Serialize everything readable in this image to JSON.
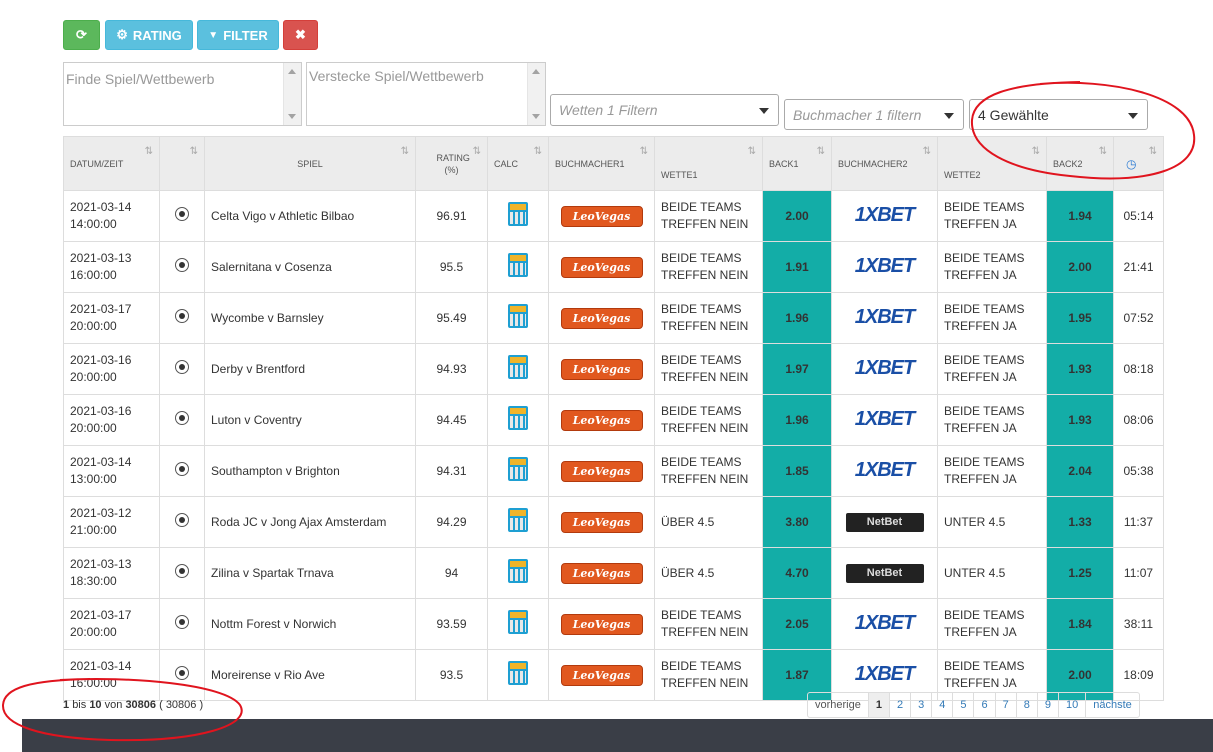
{
  "toolbar": {
    "refresh_icon": "refresh-icon",
    "rating_label": "RATING",
    "filter_label": "FILTER",
    "close_glyph": "✖",
    "refresh_glyph": "⟳",
    "rating_glyph": "⚙",
    "filter_glyph": "▼"
  },
  "filters": {
    "find_placeholder": "Finde Spiel/Wettbewerb",
    "hide_placeholder": "Verstecke Spiel/Wettbewerb",
    "bets_placeholder": "Wetten 1 Filtern",
    "bookmaker_placeholder": "Buchmacher 1 filtern",
    "selected_value": "4 Gewählte"
  },
  "table": {
    "headers": [
      "DATUM/ZEIT",
      "",
      "SPIEL",
      "RATING (%)",
      "CALC",
      "BUCHMACHER1",
      "WETTE1",
      "BACK1",
      "BUCHMACHER2",
      "WETTE2",
      "BACK2",
      ""
    ],
    "sort_glyph": "⇅",
    "clock_glyph": "◷",
    "rows": [
      {
        "date": "2021-03-14",
        "time": "14:00:00",
        "match": "Celta Vigo v Athletic Bilbao",
        "rating": "96.91",
        "bm1": "LeoVegas",
        "bet1a": "BEIDE TEAMS",
        "bet1b": "TREFFEN NEIN",
        "back1": "2.00",
        "bm2": "1XBET",
        "bet2a": "BEIDE TEAMS",
        "bet2b": "TREFFEN JA",
        "back2": "1.94",
        "timer": "05:14"
      },
      {
        "date": "2021-03-13",
        "time": "16:00:00",
        "match": "Salernitana v Cosenza",
        "rating": "95.5",
        "bm1": "LeoVegas",
        "bet1a": "BEIDE TEAMS",
        "bet1b": "TREFFEN NEIN",
        "back1": "1.91",
        "bm2": "1XBET",
        "bet2a": "BEIDE TEAMS",
        "bet2b": "TREFFEN JA",
        "back2": "2.00",
        "timer": "21:41"
      },
      {
        "date": "2021-03-17",
        "time": "20:00:00",
        "match": "Wycombe v Barnsley",
        "rating": "95.49",
        "bm1": "LeoVegas",
        "bet1a": "BEIDE TEAMS",
        "bet1b": "TREFFEN NEIN",
        "back1": "1.96",
        "bm2": "1XBET",
        "bet2a": "BEIDE TEAMS",
        "bet2b": "TREFFEN JA",
        "back2": "1.95",
        "timer": "07:52"
      },
      {
        "date": "2021-03-16",
        "time": "20:00:00",
        "match": "Derby v Brentford",
        "rating": "94.93",
        "bm1": "LeoVegas",
        "bet1a": "BEIDE TEAMS",
        "bet1b": "TREFFEN NEIN",
        "back1": "1.97",
        "bm2": "1XBET",
        "bet2a": "BEIDE TEAMS",
        "bet2b": "TREFFEN JA",
        "back2": "1.93",
        "timer": "08:18"
      },
      {
        "date": "2021-03-16",
        "time": "20:00:00",
        "match": "Luton v Coventry",
        "rating": "94.45",
        "bm1": "LeoVegas",
        "bet1a": "BEIDE TEAMS",
        "bet1b": "TREFFEN NEIN",
        "back1": "1.96",
        "bm2": "1XBET",
        "bet2a": "BEIDE TEAMS",
        "bet2b": "TREFFEN JA",
        "back2": "1.93",
        "timer": "08:06"
      },
      {
        "date": "2021-03-14",
        "time": "13:00:00",
        "match": "Southampton v Brighton",
        "rating": "94.31",
        "bm1": "LeoVegas",
        "bet1a": "BEIDE TEAMS",
        "bet1b": "TREFFEN NEIN",
        "back1": "1.85",
        "bm2": "1XBET",
        "bet2a": "BEIDE TEAMS",
        "bet2b": "TREFFEN JA",
        "back2": "2.04",
        "timer": "05:38"
      },
      {
        "date": "2021-03-12",
        "time": "21:00:00",
        "match": "Roda JC v Jong Ajax Amsterdam",
        "rating": "94.29",
        "bm1": "LeoVegas",
        "bet1a": "ÜBER 4.5",
        "bet1b": "",
        "back1": "3.80",
        "bm2": "NetBet",
        "bet2a": "UNTER 4.5",
        "bet2b": "",
        "back2": "1.33",
        "timer": "11:37"
      },
      {
        "date": "2021-03-13",
        "time": "18:30:00",
        "match": "Zilina v Spartak Trnava",
        "rating": "94",
        "bm1": "LeoVegas",
        "bet1a": "ÜBER 4.5",
        "bet1b": "",
        "back1": "4.70",
        "bm2": "NetBet",
        "bet2a": "UNTER 4.5",
        "bet2b": "",
        "back2": "1.25",
        "timer": "11:07"
      },
      {
        "date": "2021-03-17",
        "time": "20:00:00",
        "match": "Nottm Forest v Norwich",
        "rating": "93.59",
        "bm1": "LeoVegas",
        "bet1a": "BEIDE TEAMS",
        "bet1b": "TREFFEN NEIN",
        "back1": "2.05",
        "bm2": "1XBET",
        "bet2a": "BEIDE TEAMS",
        "bet2b": "TREFFEN JA",
        "back2": "1.84",
        "timer": "38:11"
      },
      {
        "date": "2021-03-14",
        "time": "16:00:00",
        "match": "Moreirense v Rio Ave",
        "rating": "93.5",
        "bm1": "LeoVegas",
        "bet1a": "BEIDE TEAMS",
        "bet1b": "TREFFEN NEIN",
        "back1": "1.87",
        "bm2": "1XBET",
        "bet2a": "BEIDE TEAMS",
        "bet2b": "TREFFEN JA",
        "back2": "2.00",
        "timer": "18:09"
      }
    ]
  },
  "info": {
    "from": "1",
    "bis": "bis",
    "to": "10",
    "von": "von",
    "total": "30806",
    "filtered": "( 30806 )"
  },
  "pagination": {
    "prev": "vorherige",
    "pages": [
      "1",
      "2",
      "3",
      "4",
      "5",
      "6",
      "7",
      "8",
      "9",
      "10"
    ],
    "next": "nächste"
  },
  "colors": {
    "back": "#13ada7",
    "annotation": "#e0141e"
  }
}
